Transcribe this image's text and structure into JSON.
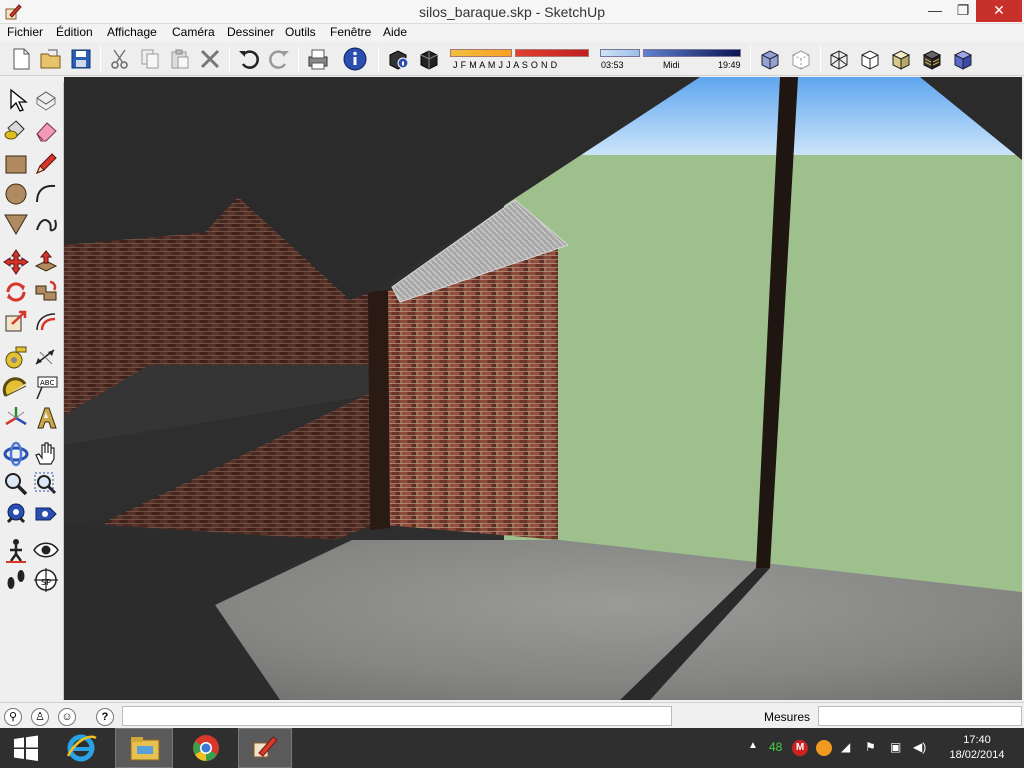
{
  "window": {
    "title": "silos_baraque.skp - SketchUp",
    "minimize": "—",
    "maximize": "❐",
    "close": "✕"
  },
  "menu": [
    "Fichier",
    "Édition",
    "Affichage",
    "Caméra",
    "Dessiner",
    "Outils",
    "Fenêtre",
    "Aide"
  ],
  "shadow": {
    "months": "J F M A M J J A S O N D",
    "time_start": "03:53",
    "time_mid": "Midi",
    "time_end": "19:49"
  },
  "status": {
    "measures_label": "Mesures",
    "help_icon": "?"
  },
  "taskbar": {
    "tray_number": "48",
    "time": "17:40",
    "date": "18/02/2014"
  },
  "colors": {
    "sky_top": "#6fb2f0",
    "ground": "#9ec08d",
    "brick": "#7b3f30",
    "floor": "#8e8f8d",
    "ceiling": "#2b2b2b",
    "close_button": "#c7302b",
    "taskbar": "#2f2f2f"
  }
}
